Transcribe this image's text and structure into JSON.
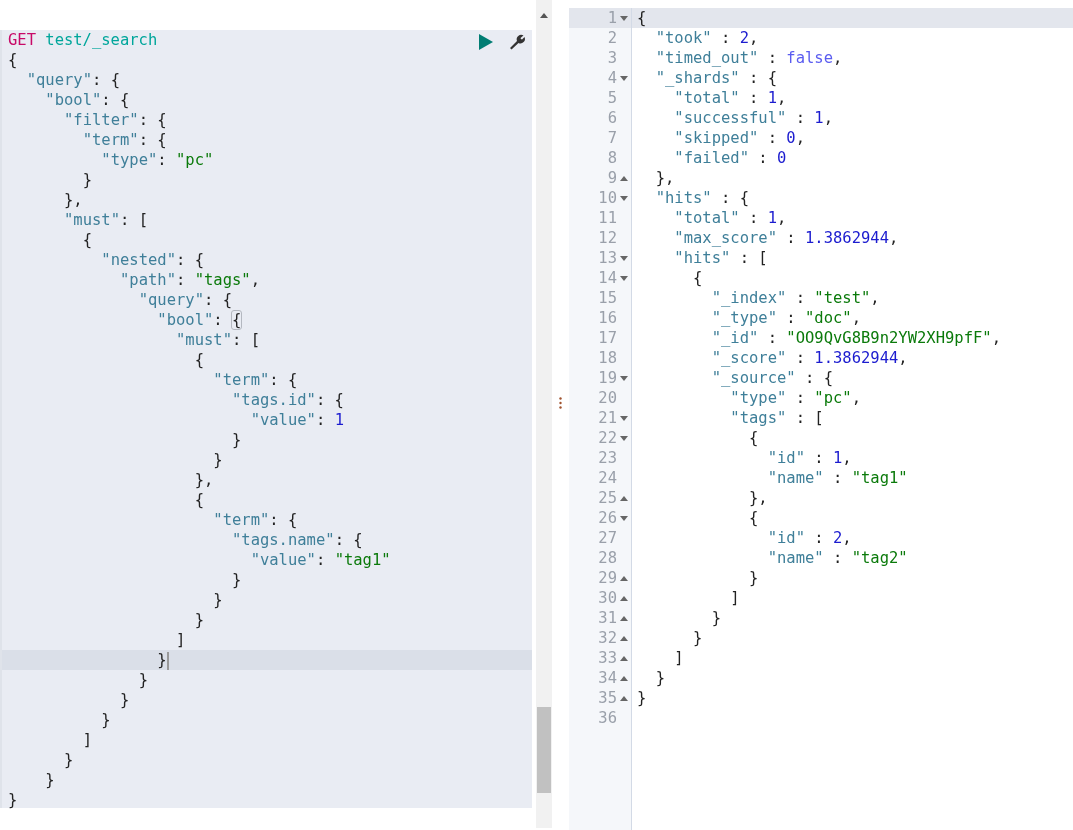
{
  "request_editor": {
    "lines": [
      {
        "active": false,
        "tokens": [
          {
            "kind": "method",
            "text": "GET"
          },
          {
            "kind": "url",
            "text": "test/_search"
          }
        ]
      },
      {
        "active": false,
        "tokens": [
          {
            "kind": "punct",
            "text": "{"
          }
        ]
      },
      {
        "active": false,
        "tokens": [
          {
            "kind": "key",
            "text": "  \"query\""
          },
          {
            "kind": "punct",
            "text": ": {"
          }
        ]
      },
      {
        "active": false,
        "tokens": [
          {
            "kind": "key",
            "text": "    \"bool\""
          },
          {
            "kind": "punct",
            "text": ": {"
          }
        ]
      },
      {
        "active": false,
        "tokens": [
          {
            "kind": "key",
            "text": "      \"filter\""
          },
          {
            "kind": "punct",
            "text": ": {"
          }
        ]
      },
      {
        "active": false,
        "tokens": [
          {
            "kind": "key",
            "text": "        \"term\""
          },
          {
            "kind": "punct",
            "text": ": {"
          }
        ]
      },
      {
        "active": false,
        "tokens": [
          {
            "kind": "key",
            "text": "          \"type\""
          },
          {
            "kind": "punct",
            "text": ": "
          },
          {
            "kind": "string",
            "text": "\"pc\""
          }
        ]
      },
      {
        "active": false,
        "tokens": [
          {
            "kind": "punct",
            "text": "        }"
          }
        ]
      },
      {
        "active": false,
        "tokens": [
          {
            "kind": "punct",
            "text": "      },"
          }
        ]
      },
      {
        "active": false,
        "tokens": [
          {
            "kind": "key",
            "text": "      \"must\""
          },
          {
            "kind": "punct",
            "text": ": ["
          }
        ]
      },
      {
        "active": false,
        "tokens": [
          {
            "kind": "punct",
            "text": "        {"
          }
        ]
      },
      {
        "active": false,
        "tokens": [
          {
            "kind": "key",
            "text": "          \"nested\""
          },
          {
            "kind": "punct",
            "text": ": {"
          }
        ]
      },
      {
        "active": false,
        "tokens": [
          {
            "kind": "key",
            "text": "            \"path\""
          },
          {
            "kind": "punct",
            "text": ": "
          },
          {
            "kind": "string",
            "text": "\"tags\""
          },
          {
            "kind": "punct",
            "text": ","
          }
        ]
      },
      {
        "active": false,
        "tokens": [
          {
            "kind": "key",
            "text": "              \"query\""
          },
          {
            "kind": "punct",
            "text": ": {"
          }
        ]
      },
      {
        "active": false,
        "tokens": [
          {
            "kind": "key",
            "text": "                \"bool\""
          },
          {
            "kind": "punct",
            "text": ": "
          },
          {
            "kind": "match",
            "text": "{"
          }
        ]
      },
      {
        "active": false,
        "tokens": [
          {
            "kind": "key",
            "text": "                  \"must\""
          },
          {
            "kind": "punct",
            "text": ": ["
          }
        ]
      },
      {
        "active": false,
        "tokens": [
          {
            "kind": "punct",
            "text": "                    {"
          }
        ]
      },
      {
        "active": false,
        "tokens": [
          {
            "kind": "key",
            "text": "                      \"term\""
          },
          {
            "kind": "punct",
            "text": ": {"
          }
        ]
      },
      {
        "active": false,
        "tokens": [
          {
            "kind": "key",
            "text": "                        \"tags.id\""
          },
          {
            "kind": "punct",
            "text": ": {"
          }
        ]
      },
      {
        "active": false,
        "tokens": [
          {
            "kind": "key",
            "text": "                          \"value\""
          },
          {
            "kind": "punct",
            "text": ": "
          },
          {
            "kind": "number",
            "text": "1"
          }
        ]
      },
      {
        "active": false,
        "tokens": [
          {
            "kind": "punct",
            "text": "                        }"
          }
        ]
      },
      {
        "active": false,
        "tokens": [
          {
            "kind": "punct",
            "text": "                      }"
          }
        ]
      },
      {
        "active": false,
        "tokens": [
          {
            "kind": "punct",
            "text": "                    },"
          }
        ]
      },
      {
        "active": false,
        "tokens": [
          {
            "kind": "punct",
            "text": "                    {"
          }
        ]
      },
      {
        "active": false,
        "tokens": [
          {
            "kind": "key",
            "text": "                      \"term\""
          },
          {
            "kind": "punct",
            "text": ": {"
          }
        ]
      },
      {
        "active": false,
        "tokens": [
          {
            "kind": "key",
            "text": "                        \"tags.name\""
          },
          {
            "kind": "punct",
            "text": ": {"
          }
        ]
      },
      {
        "active": false,
        "tokens": [
          {
            "kind": "key",
            "text": "                          \"value\""
          },
          {
            "kind": "punct",
            "text": ": "
          },
          {
            "kind": "string",
            "text": "\"tag1\""
          }
        ]
      },
      {
        "active": false,
        "tokens": [
          {
            "kind": "punct",
            "text": "                        }"
          }
        ]
      },
      {
        "active": false,
        "tokens": [
          {
            "kind": "punct",
            "text": "                      }"
          }
        ]
      },
      {
        "active": false,
        "tokens": [
          {
            "kind": "punct",
            "text": "                    }"
          }
        ]
      },
      {
        "active": false,
        "tokens": [
          {
            "kind": "punct",
            "text": "                  ]"
          }
        ]
      },
      {
        "active": true,
        "tokens": [
          {
            "kind": "punct",
            "text": "                }"
          }
        ]
      },
      {
        "active": false,
        "tokens": [
          {
            "kind": "punct",
            "text": "              }"
          }
        ]
      },
      {
        "active": false,
        "tokens": [
          {
            "kind": "punct",
            "text": "            }"
          }
        ]
      },
      {
        "active": false,
        "tokens": [
          {
            "kind": "punct",
            "text": "          }"
          }
        ]
      },
      {
        "active": false,
        "tokens": [
          {
            "kind": "punct",
            "text": "        ]"
          }
        ]
      },
      {
        "active": false,
        "tokens": [
          {
            "kind": "punct",
            "text": "      }"
          }
        ]
      },
      {
        "active": false,
        "tokens": [
          {
            "kind": "punct",
            "text": "    }"
          }
        ]
      },
      {
        "active": false,
        "tokens": [
          {
            "kind": "punct",
            "text": "}"
          }
        ]
      }
    ]
  },
  "response_editor": {
    "lines": [
      {
        "number": "1",
        "kind": "fold-start",
        "active": true,
        "tokens": [
          {
            "kind": "punct",
            "text": "{"
          }
        ]
      },
      {
        "number": "2",
        "kind": "plain",
        "active": false,
        "tokens": [
          {
            "kind": "key",
            "text": "  \"took\""
          },
          {
            "kind": "punct",
            "text": " : "
          },
          {
            "kind": "number",
            "text": "2"
          },
          {
            "kind": "punct",
            "text": ","
          }
        ]
      },
      {
        "number": "3",
        "kind": "plain",
        "active": false,
        "tokens": [
          {
            "kind": "key",
            "text": "  \"timed_out\""
          },
          {
            "kind": "punct",
            "text": " : "
          },
          {
            "kind": "bool",
            "text": "false"
          },
          {
            "kind": "punct",
            "text": ","
          }
        ]
      },
      {
        "number": "4",
        "kind": "fold-start",
        "active": false,
        "tokens": [
          {
            "kind": "key",
            "text": "  \"_shards\""
          },
          {
            "kind": "punct",
            "text": " : {"
          }
        ]
      },
      {
        "number": "5",
        "kind": "plain",
        "active": false,
        "tokens": [
          {
            "kind": "key",
            "text": "    \"total\""
          },
          {
            "kind": "punct",
            "text": " : "
          },
          {
            "kind": "number",
            "text": "1"
          },
          {
            "kind": "punct",
            "text": ","
          }
        ]
      },
      {
        "number": "6",
        "kind": "plain",
        "active": false,
        "tokens": [
          {
            "kind": "key",
            "text": "    \"successful\""
          },
          {
            "kind": "punct",
            "text": " : "
          },
          {
            "kind": "number",
            "text": "1"
          },
          {
            "kind": "punct",
            "text": ","
          }
        ]
      },
      {
        "number": "7",
        "kind": "plain",
        "active": false,
        "tokens": [
          {
            "kind": "key",
            "text": "    \"skipped\""
          },
          {
            "kind": "punct",
            "text": " : "
          },
          {
            "kind": "number",
            "text": "0"
          },
          {
            "kind": "punct",
            "text": ","
          }
        ]
      },
      {
        "number": "8",
        "kind": "plain",
        "active": false,
        "tokens": [
          {
            "kind": "key",
            "text": "    \"failed\""
          },
          {
            "kind": "punct",
            "text": " : "
          },
          {
            "kind": "number",
            "text": "0"
          }
        ]
      },
      {
        "number": "9",
        "kind": "fold-end",
        "active": false,
        "tokens": [
          {
            "kind": "punct",
            "text": "  },"
          }
        ]
      },
      {
        "number": "10",
        "kind": "fold-start",
        "active": false,
        "tokens": [
          {
            "kind": "key",
            "text": "  \"hits\""
          },
          {
            "kind": "punct",
            "text": " : {"
          }
        ]
      },
      {
        "number": "11",
        "kind": "plain",
        "active": false,
        "tokens": [
          {
            "kind": "key",
            "text": "    \"total\""
          },
          {
            "kind": "punct",
            "text": " : "
          },
          {
            "kind": "number",
            "text": "1"
          },
          {
            "kind": "punct",
            "text": ","
          }
        ]
      },
      {
        "number": "12",
        "kind": "plain",
        "active": false,
        "tokens": [
          {
            "kind": "key",
            "text": "    \"max_score\""
          },
          {
            "kind": "punct",
            "text": " : "
          },
          {
            "kind": "number",
            "text": "1.3862944"
          },
          {
            "kind": "punct",
            "text": ","
          }
        ]
      },
      {
        "number": "13",
        "kind": "fold-start",
        "active": false,
        "tokens": [
          {
            "kind": "key",
            "text": "    \"hits\""
          },
          {
            "kind": "punct",
            "text": " : ["
          }
        ]
      },
      {
        "number": "14",
        "kind": "fold-start",
        "active": false,
        "tokens": [
          {
            "kind": "punct",
            "text": "      {"
          }
        ]
      },
      {
        "number": "15",
        "kind": "plain",
        "active": false,
        "tokens": [
          {
            "kind": "key",
            "text": "        \"_index\""
          },
          {
            "kind": "punct",
            "text": " : "
          },
          {
            "kind": "string",
            "text": "\"test\""
          },
          {
            "kind": "punct",
            "text": ","
          }
        ]
      },
      {
        "number": "16",
        "kind": "plain",
        "active": false,
        "tokens": [
          {
            "kind": "key",
            "text": "        \"_type\""
          },
          {
            "kind": "punct",
            "text": " : "
          },
          {
            "kind": "string",
            "text": "\"doc\""
          },
          {
            "kind": "punct",
            "text": ","
          }
        ]
      },
      {
        "number": "17",
        "kind": "plain",
        "active": false,
        "tokens": [
          {
            "kind": "key",
            "text": "        \"_id\""
          },
          {
            "kind": "punct",
            "text": " : "
          },
          {
            "kind": "string",
            "text": "\"OO9QvG8B9n2YW2XH9pfF\""
          },
          {
            "kind": "punct",
            "text": ","
          }
        ]
      },
      {
        "number": "18",
        "kind": "plain",
        "active": false,
        "tokens": [
          {
            "kind": "key",
            "text": "        \"_score\""
          },
          {
            "kind": "punct",
            "text": " : "
          },
          {
            "kind": "number",
            "text": "1.3862944"
          },
          {
            "kind": "punct",
            "text": ","
          }
        ]
      },
      {
        "number": "19",
        "kind": "fold-start",
        "active": false,
        "tokens": [
          {
            "kind": "key",
            "text": "        \"_source\""
          },
          {
            "kind": "punct",
            "text": " : {"
          }
        ]
      },
      {
        "number": "20",
        "kind": "plain",
        "active": false,
        "tokens": [
          {
            "kind": "key",
            "text": "          \"type\""
          },
          {
            "kind": "punct",
            "text": " : "
          },
          {
            "kind": "string",
            "text": "\"pc\""
          },
          {
            "kind": "punct",
            "text": ","
          }
        ]
      },
      {
        "number": "21",
        "kind": "fold-start",
        "active": false,
        "tokens": [
          {
            "kind": "key",
            "text": "          \"tags\""
          },
          {
            "kind": "punct",
            "text": " : ["
          }
        ]
      },
      {
        "number": "22",
        "kind": "fold-start",
        "active": false,
        "tokens": [
          {
            "kind": "punct",
            "text": "            {"
          }
        ]
      },
      {
        "number": "23",
        "kind": "plain",
        "active": false,
        "tokens": [
          {
            "kind": "key",
            "text": "              \"id\""
          },
          {
            "kind": "punct",
            "text": " : "
          },
          {
            "kind": "number",
            "text": "1"
          },
          {
            "kind": "punct",
            "text": ","
          }
        ]
      },
      {
        "number": "24",
        "kind": "plain",
        "active": false,
        "tokens": [
          {
            "kind": "key",
            "text": "              \"name\""
          },
          {
            "kind": "punct",
            "text": " : "
          },
          {
            "kind": "string",
            "text": "\"tag1\""
          }
        ]
      },
      {
        "number": "25",
        "kind": "fold-end",
        "active": false,
        "tokens": [
          {
            "kind": "punct",
            "text": "            },"
          }
        ]
      },
      {
        "number": "26",
        "kind": "fold-start",
        "active": false,
        "tokens": [
          {
            "kind": "punct",
            "text": "            {"
          }
        ]
      },
      {
        "number": "27",
        "kind": "plain",
        "active": false,
        "tokens": [
          {
            "kind": "key",
            "text": "              \"id\""
          },
          {
            "kind": "punct",
            "text": " : "
          },
          {
            "kind": "number",
            "text": "2"
          },
          {
            "kind": "punct",
            "text": ","
          }
        ]
      },
      {
        "number": "28",
        "kind": "plain",
        "active": false,
        "tokens": [
          {
            "kind": "key",
            "text": "              \"name\""
          },
          {
            "kind": "punct",
            "text": " : "
          },
          {
            "kind": "string",
            "text": "\"tag2\""
          }
        ]
      },
      {
        "number": "29",
        "kind": "fold-end",
        "active": false,
        "tokens": [
          {
            "kind": "punct",
            "text": "            }"
          }
        ]
      },
      {
        "number": "30",
        "kind": "fold-end",
        "active": false,
        "tokens": [
          {
            "kind": "punct",
            "text": "          ]"
          }
        ]
      },
      {
        "number": "31",
        "kind": "fold-end",
        "active": false,
        "tokens": [
          {
            "kind": "punct",
            "text": "        }"
          }
        ]
      },
      {
        "number": "32",
        "kind": "fold-end",
        "active": false,
        "tokens": [
          {
            "kind": "punct",
            "text": "      }"
          }
        ]
      },
      {
        "number": "33",
        "kind": "fold-end",
        "active": false,
        "tokens": [
          {
            "kind": "punct",
            "text": "    ]"
          }
        ]
      },
      {
        "number": "34",
        "kind": "fold-end",
        "active": false,
        "tokens": [
          {
            "kind": "punct",
            "text": "  }"
          }
        ]
      },
      {
        "number": "35",
        "kind": "fold-end",
        "active": false,
        "tokens": [
          {
            "kind": "punct",
            "text": "}"
          }
        ]
      },
      {
        "number": "36",
        "kind": "plain",
        "active": false
      }
    ]
  }
}
